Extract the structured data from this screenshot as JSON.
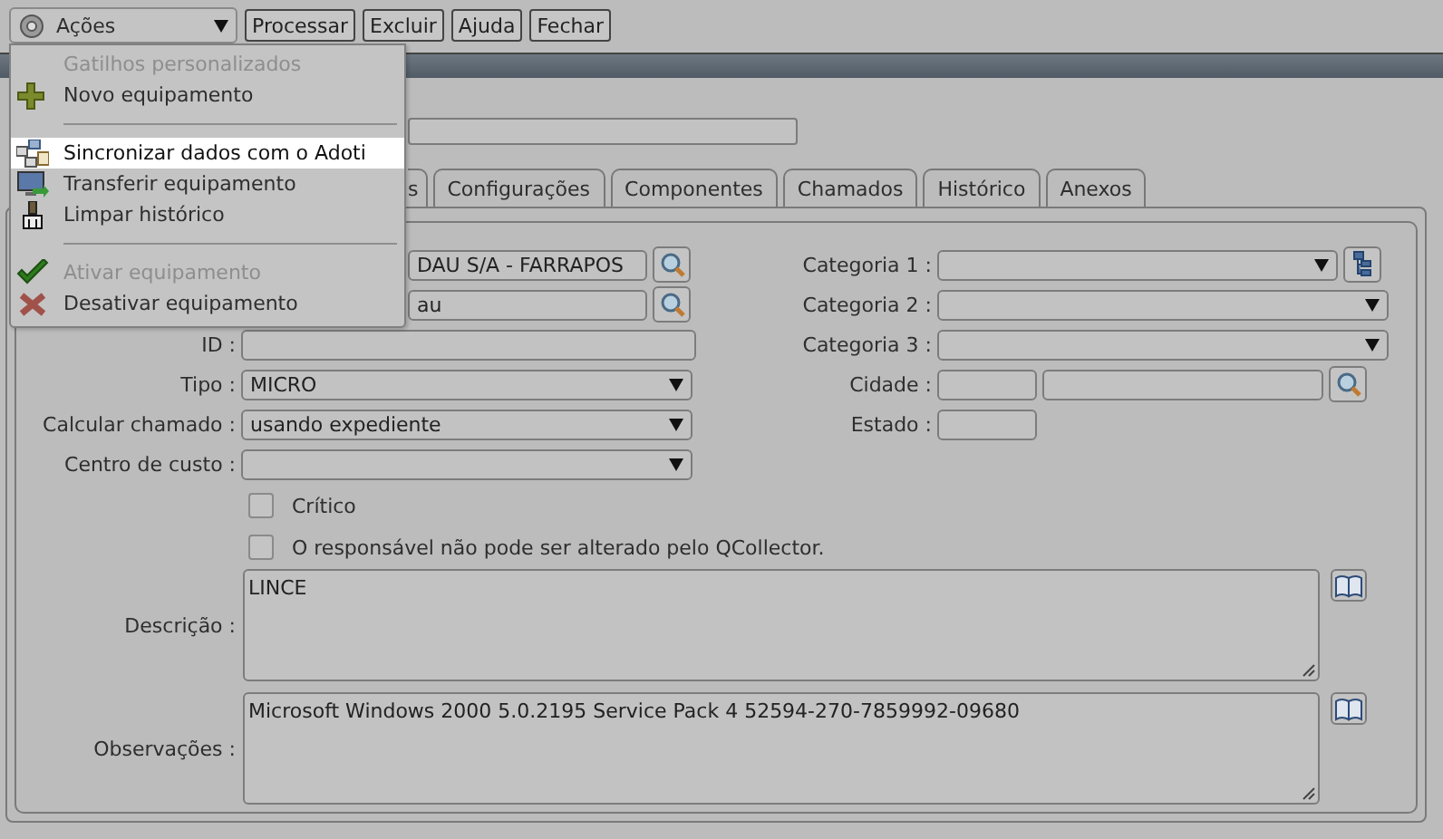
{
  "toolbar": {
    "actions_menu": {
      "label": "Ações",
      "expanded": true
    },
    "buttons": [
      "Processar",
      "Excluir",
      "Ajuda",
      "Fechar"
    ]
  },
  "menu": {
    "items": [
      {
        "kind": "header",
        "label": "Gatilhos personalizados"
      },
      {
        "kind": "item",
        "label": "Novo equipamento",
        "disabled": false,
        "selected": false
      },
      {
        "kind": "separator"
      },
      {
        "kind": "item",
        "label": "Sincronizar dados com o Adoti",
        "disabled": false,
        "selected": true
      },
      {
        "kind": "item",
        "label": "Transferir equipamento",
        "disabled": false,
        "selected": false
      },
      {
        "kind": "item",
        "label": "Limpar histórico",
        "disabled": false,
        "selected": false
      },
      {
        "kind": "separator"
      },
      {
        "kind": "item",
        "label": "Ativar equipamento",
        "disabled": true,
        "selected": false
      },
      {
        "kind": "item",
        "label": "Desativar equipamento",
        "disabled": false,
        "selected": false
      }
    ]
  },
  "header_field": {
    "kind": "text"
  },
  "tabs": [
    {
      "label": "s",
      "selected": false
    },
    {
      "label": "Configurações",
      "selected": false
    },
    {
      "label": "Componentes",
      "selected": false
    },
    {
      "label": "Chamados",
      "selected": false
    },
    {
      "label": "Histórico",
      "selected": false
    },
    {
      "label": "Anexos",
      "selected": false
    }
  ],
  "left_fields": [
    {
      "kind": "search",
      "value": "DAU S/A - FARRAPOS"
    },
    {
      "kind": "search",
      "value": "au"
    },
    {
      "kind": "text",
      "label": "ID :"
    },
    {
      "kind": "select",
      "label": "Tipo :",
      "value": "MICRO"
    },
    {
      "kind": "select",
      "label": "Calcular chamado :",
      "value": "usando expediente"
    },
    {
      "kind": "select",
      "label": "Centro de custo :"
    }
  ],
  "right_fields": [
    {
      "kind": "tree-select",
      "label": "Categoria 1 :"
    },
    {
      "kind": "select",
      "label": "Categoria 2 :"
    },
    {
      "kind": "select",
      "label": "Categoria 3 :"
    },
    {
      "kind": "city",
      "label": "Cidade :"
    },
    {
      "kind": "short",
      "label": "Estado :"
    }
  ],
  "checkboxes": [
    {
      "label": "Crítico",
      "checked": false
    },
    {
      "label": "O responsável não pode ser alterado pelo QCollector.",
      "checked": false
    }
  ],
  "text_areas": [
    {
      "label": "Descrição :",
      "value": "LINCE"
    },
    {
      "label": "Observações :",
      "value": "Microsoft Windows 2000 5.0.2195 Service Pack 4 52594-270-7859992-09680"
    }
  ]
}
